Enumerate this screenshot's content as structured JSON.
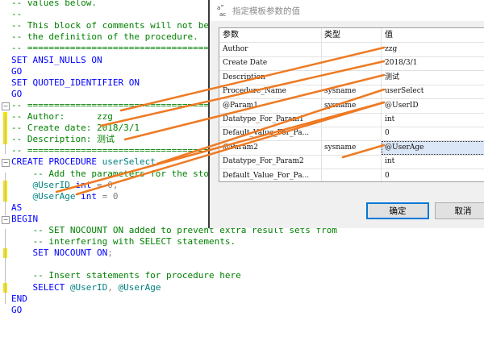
{
  "editor": {
    "lines": [
      [
        {
          "c": "cm",
          "t": "-- values below."
        }
      ],
      [
        {
          "c": "cm",
          "t": "--"
        }
      ],
      [
        {
          "c": "cm",
          "t": "-- This block of comments will not be"
        }
      ],
      [
        {
          "c": "cm",
          "t": "-- the definition of the procedure."
        }
      ],
      [
        {
          "c": "cm",
          "t": "-- ======================================="
        }
      ],
      [
        {
          "c": "kw",
          "t": "SET ANSI_NULLS ON"
        }
      ],
      [
        {
          "c": "kw",
          "t": "GO"
        }
      ],
      [
        {
          "c": "kw",
          "t": "SET QUOTED_IDENTIFIER ON"
        }
      ],
      [
        {
          "c": "kw",
          "t": "GO"
        }
      ],
      [
        {
          "c": "cm",
          "t": "-- ======================================="
        }
      ],
      [
        {
          "c": "cm",
          "t": "-- Author:      zzg"
        }
      ],
      [
        {
          "c": "cm",
          "t": "-- Create date: 2018/3/1"
        }
      ],
      [
        {
          "c": "cm",
          "t": "-- Description: 测试"
        }
      ],
      [
        {
          "c": "cm",
          "t": "-- ======================================="
        }
      ],
      [
        {
          "c": "kw",
          "t": "CREATE PROCEDURE "
        },
        {
          "c": "id",
          "t": "userSelect"
        }
      ],
      [
        {
          "c": "cm",
          "t": "    -- Add the parameters for the sto"
        }
      ],
      [
        {
          "c": "id",
          "t": "    @UserID "
        },
        {
          "c": "kw",
          "t": "int"
        },
        {
          "c": "gr",
          "t": " = 0,"
        }
      ],
      [
        {
          "c": "id",
          "t": "    @UserAge "
        },
        {
          "c": "kw",
          "t": "int"
        },
        {
          "c": "gr",
          "t": " = 0"
        }
      ],
      [
        {
          "c": "kw",
          "t": "AS"
        }
      ],
      [
        {
          "c": "kw",
          "t": "BEGIN"
        }
      ],
      [
        {
          "c": "cm",
          "t": "    -- SET NOCOUNT ON added to prevent extra result sets from"
        }
      ],
      [
        {
          "c": "cm",
          "t": "    -- interfering with SELECT statements."
        }
      ],
      [
        {
          "c": "kw",
          "t": "    SET NOCOUNT ON"
        },
        {
          "c": "gr",
          "t": ";"
        }
      ],
      [
        {
          "c": "cn",
          "t": ""
        }
      ],
      [
        {
          "c": "cm",
          "t": "    -- Insert statements for procedure here"
        }
      ],
      [
        {
          "c": "kw",
          "t": "    SELECT "
        },
        {
          "c": "id",
          "t": "@UserID"
        },
        {
          "c": "gr",
          "t": ", "
        },
        {
          "c": "id",
          "t": "@UserAge"
        }
      ],
      [
        {
          "c": "kw",
          "t": "END"
        }
      ],
      [
        {
          "c": "kw",
          "t": "GO"
        }
      ]
    ]
  },
  "dialog": {
    "title": "指定模板参数的值",
    "icon_text": "a̧\nac",
    "columns": [
      "参数",
      "类型",
      "值"
    ],
    "rows": [
      {
        "param": "Author",
        "type": "",
        "value": "zzg"
      },
      {
        "param": "Create Date",
        "type": "",
        "value": "2018/3/1"
      },
      {
        "param": "Description",
        "type": "",
        "value": "测试"
      },
      {
        "param": "Procedure_Name",
        "type": "sysname",
        "value": "userSelect"
      },
      {
        "param": "@Param1",
        "type": "sysname",
        "value": "@UserID"
      },
      {
        "param": "Datatype_For_Param1",
        "type": "",
        "value": "int"
      },
      {
        "param": "Default_Value_For_Pa...",
        "type": "",
        "value": "0"
      },
      {
        "param": "@Param2",
        "type": "sysname",
        "value": "@UserAge"
      },
      {
        "param": "Datatype_For_Param2",
        "type": "",
        "value": "int"
      },
      {
        "param": "Default_Value_For_Pa...",
        "type": "",
        "value": "0"
      }
    ],
    "selected_row": 7,
    "ok_label": "确定",
    "cancel_label": "取消"
  },
  "colors": {
    "annotation": "#ee7a22",
    "comment": "#008000",
    "keyword": "#0000ff",
    "identifier": "#008080"
  }
}
